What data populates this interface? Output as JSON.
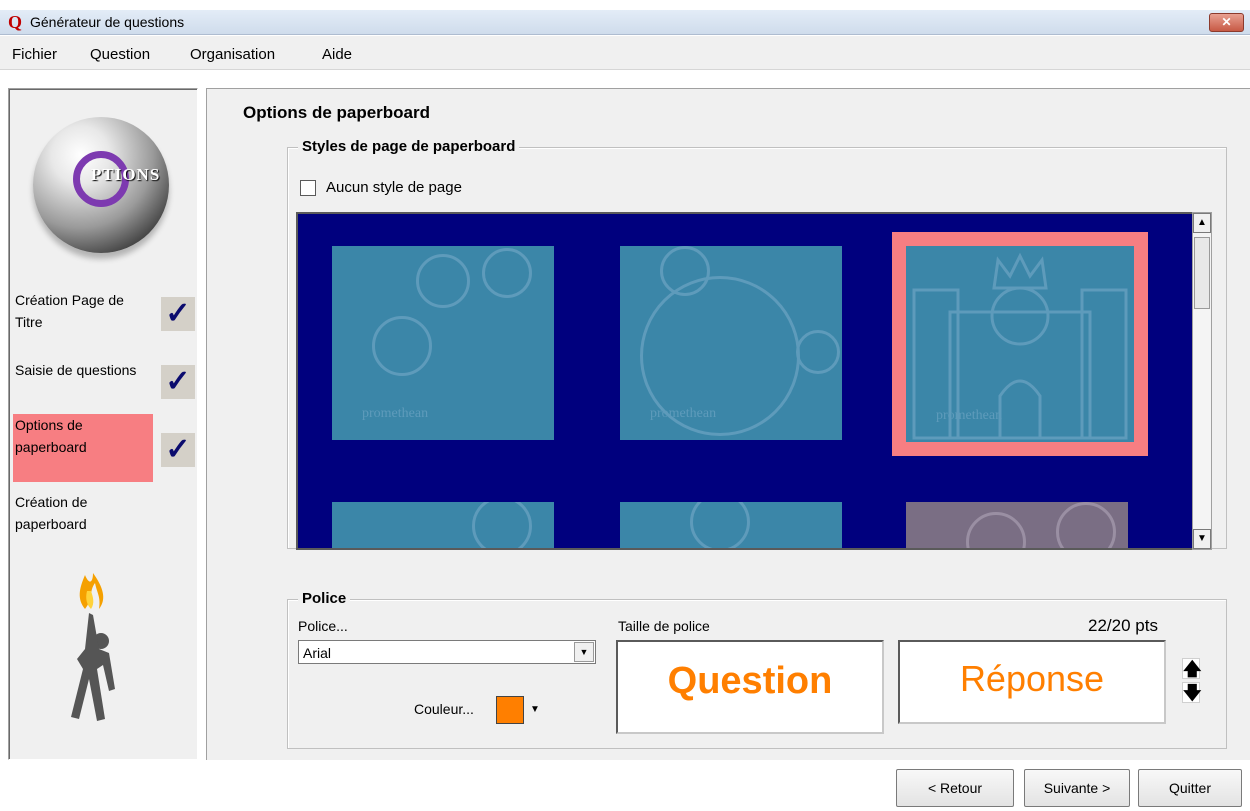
{
  "window": {
    "title": "Générateur de questions",
    "close_label": "✕"
  },
  "menu": {
    "items": [
      "Fichier",
      "Question",
      "Organisation",
      "Aide"
    ]
  },
  "sidebar": {
    "logo_text": "PTIONS",
    "steps": [
      {
        "label": "Création Page de Titre",
        "checked": true,
        "active": false
      },
      {
        "label": "Saisie de questions",
        "checked": true,
        "active": false
      },
      {
        "label": "Options de paperboard",
        "checked": true,
        "active": true
      },
      {
        "label": "Création de paperboard",
        "checked": false,
        "active": false
      }
    ],
    "check_glyph": "✓"
  },
  "main": {
    "title": "Options de paperboard",
    "styles_group": {
      "legend": "Styles de page de paperboard",
      "no_style_label": "Aucun style de page",
      "no_style_checked": false,
      "thumbnails": [
        {
          "name": "pencil-faces",
          "watermark": "promethean",
          "selected": false
        },
        {
          "name": "globe-faces",
          "watermark": "promethean",
          "selected": false
        },
        {
          "name": "castle-king",
          "watermark": "promethean",
          "selected": true
        },
        {
          "name": "hash-face",
          "watermark": "",
          "selected": false
        },
        {
          "name": "faces-row",
          "watermark": "",
          "selected": false
        },
        {
          "name": "grey-faces",
          "watermark": "",
          "selected": false
        }
      ]
    },
    "font_group": {
      "legend": "Police",
      "font_label": "Police...",
      "font_value": "Arial",
      "size_label": "Taille de police",
      "size_value": "22/20 pts",
      "color_label": "Couleur...",
      "color": "#ff7f00",
      "question_preview": "Question",
      "answer_preview": "Réponse",
      "spin_up": "🡅",
      "spin_down": "🡇"
    }
  },
  "footer": {
    "back_label": "< Retour",
    "next_label": "Suivante >",
    "quit_label": "Quitter"
  }
}
